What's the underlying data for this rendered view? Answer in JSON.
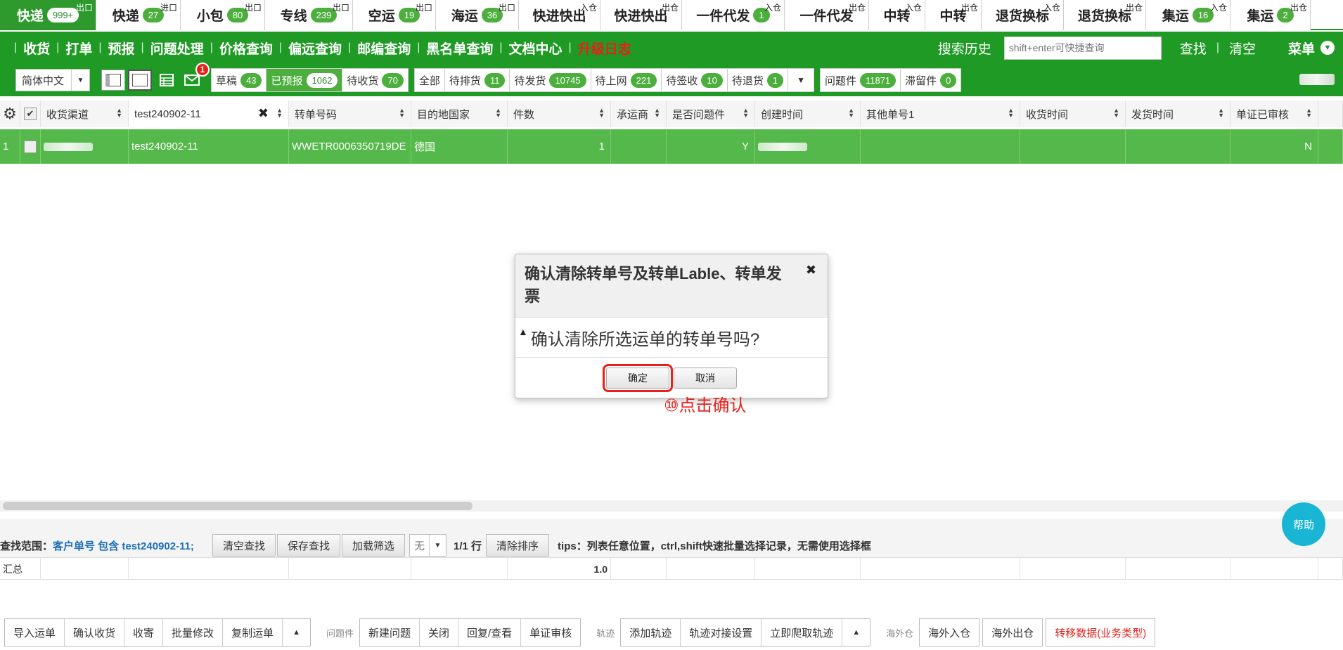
{
  "top_tabs": [
    {
      "label": "快递",
      "badge": "999+",
      "sup": "出口",
      "active": true,
      "width": 137
    },
    {
      "label": "快递",
      "badge": "27",
      "sup": "进口",
      "width": 120
    },
    {
      "label": "小包",
      "badge": "80",
      "sup": "出口",
      "width": 120
    },
    {
      "label": "专线",
      "badge": "239",
      "sup": "出口",
      "width": 125
    },
    {
      "label": "空运",
      "badge": "19",
      "sup": "出口",
      "width": 118
    },
    {
      "label": "海运",
      "badge": "36",
      "sup": "出口",
      "width": 118
    },
    {
      "label": "快进快出",
      "badge": "",
      "sup": "入仓",
      "width": 116
    },
    {
      "label": "快进快出",
      "badge": "",
      "sup": "出仓",
      "width": 116
    },
    {
      "label": "一件代发",
      "badge": "1",
      "sup": "入仓",
      "width": 146
    },
    {
      "label": "一件代发",
      "badge": "",
      "sup": "出仓",
      "width": 120
    },
    {
      "label": "中转",
      "badge": "",
      "sup": "入仓",
      "width": 80
    },
    {
      "label": "中转",
      "badge": "",
      "sup": "出仓",
      "width": 80
    },
    {
      "label": "退货换标",
      "badge": "",
      "sup": "入仓",
      "width": 117
    },
    {
      "label": "退货换标",
      "badge": "",
      "sup": "出仓",
      "width": 117
    },
    {
      "label": "集运",
      "badge": "16",
      "sup": "入仓",
      "width": 120
    },
    {
      "label": "集运",
      "badge": "2",
      "sup": "出仓",
      "width": 114
    }
  ],
  "menu": {
    "items": [
      "收货",
      "打单",
      "预报",
      "问题处理",
      "价格查询",
      "偏远查询",
      "邮编查询",
      "黑名单查询",
      "文档中心"
    ],
    "upgrade": "升级日志",
    "search_history": "搜索历史",
    "search_placeholder": "shift+enter可快捷查询",
    "find": "查找",
    "clear": "清空",
    "menu_label": "菜单"
  },
  "filterbar": {
    "language": "简体中文",
    "mail_count": "1",
    "status_group1": [
      {
        "label": "草稿",
        "badge": "43"
      },
      {
        "label": "已预报",
        "badge": "1062",
        "active": true
      },
      {
        "label": "待收货",
        "badge": "70"
      }
    ],
    "status_group2": [
      {
        "label": "全部",
        "badge": ""
      },
      {
        "label": "待排货",
        "badge": "11"
      },
      {
        "label": "待发货",
        "badge": "10745"
      },
      {
        "label": "待上网",
        "badge": "221"
      },
      {
        "label": "待签收",
        "badge": "10"
      },
      {
        "label": "待退货",
        "badge": "1"
      }
    ],
    "status_group3": [
      {
        "label": "问题件",
        "badge": "11871"
      },
      {
        "label": "滞留件",
        "badge": "0"
      }
    ]
  },
  "table": {
    "columns": [
      {
        "label": "",
        "width": 29,
        "type": "gear"
      },
      {
        "label": "",
        "width": 29,
        "type": "check"
      },
      {
        "label": "收货渠道",
        "width": 125
      },
      {
        "label": "test240902-11",
        "width": 228,
        "type": "filter"
      },
      {
        "label": "转单号码",
        "width": 174
      },
      {
        "label": "目的地国家",
        "width": 137
      },
      {
        "label": "件数",
        "width": 147,
        "right": true
      },
      {
        "label": "承运商",
        "width": 79
      },
      {
        "label": "是否问题件",
        "width": 126
      },
      {
        "label": "创建时间",
        "width": 150
      },
      {
        "label": "其他单号1",
        "width": 227
      },
      {
        "label": "收货时间",
        "width": 150
      },
      {
        "label": "发货时间",
        "width": 149
      },
      {
        "label": "单证已审核",
        "width": 125
      },
      {
        "label": "",
        "width": 35
      }
    ],
    "rows": [
      {
        "cells": [
          "1",
          "",
          "",
          "test240902-11",
          "WWETR0006350719DE",
          "德国",
          "1",
          "",
          "Y",
          "",
          "",
          "",
          "",
          "N",
          ""
        ]
      }
    ]
  },
  "bottom": {
    "range_label": "查找范围：",
    "range_value": "客户单号 包含 test240902-11;",
    "clear_search": "清空查找",
    "save_search": "保存查找",
    "load_filter": "加载筛选",
    "filter_select": "无",
    "rows": "1/1 行",
    "clear_sort": "清除排序",
    "tips": "tips：列表任意位置，ctrl,shift快速批量选择记录，无需使用选择框",
    "help": "帮助",
    "summary_label": "汇总",
    "summary_count": "1.0"
  },
  "footer": {
    "group1": [
      "导入运单",
      "确认收货",
      "收寄",
      "批量修改",
      "复制运单"
    ],
    "label_issue": "问题件",
    "group2": [
      "新建问题",
      "关闭",
      "回复/查看",
      "单证审核"
    ],
    "label_track": "轨迹",
    "group3": [
      "添加轨迹",
      "轨迹对接设置",
      "立即爬取轨迹"
    ],
    "label_overseas": "海外仓",
    "overseas_in": "海外入仓",
    "overseas_out": "海外出仓",
    "transfer": "转移数据(业务类型)"
  },
  "modal": {
    "title": "确认清除转单号及转单Lable、转单发票",
    "message": "确认清除所选运单的转单号吗?",
    "ok": "确定",
    "cancel": "取消"
  },
  "annotation": "⑩点击确认"
}
